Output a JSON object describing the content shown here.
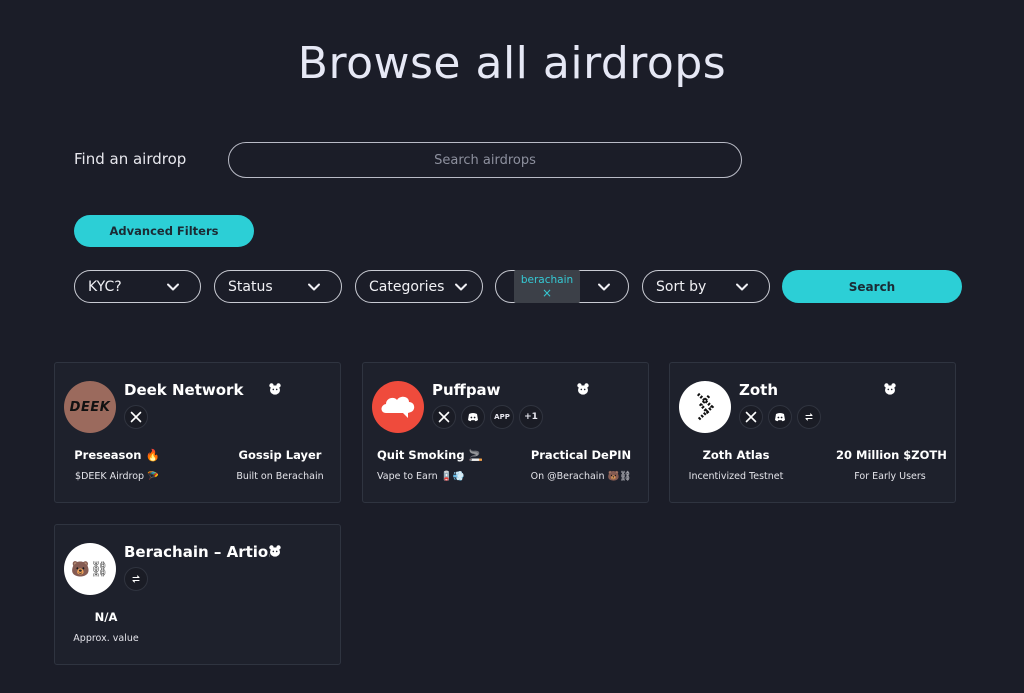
{
  "page": {
    "title": "Browse all airdrops"
  },
  "search": {
    "label": "Find an airdrop",
    "placeholder": "Search airdrops",
    "value": ""
  },
  "advanced_filters": {
    "label": "Advanced Filters"
  },
  "filters": {
    "kyc": "KYC?",
    "status": "Status",
    "categories": "Categories",
    "chain_tag": "berachain",
    "chain_tag_remove": "×",
    "sort": "Sort by"
  },
  "search_button": {
    "label": "Search"
  },
  "colors": {
    "accent": "#2ccfd6",
    "background": "#1b1d28",
    "card": "#1e212c"
  },
  "cards": [
    {
      "name": "Deek Network",
      "logo_text": "DEEK",
      "socials": [
        "x-icon"
      ],
      "left_title": "Preseason 🔥",
      "left_sub": "$DEEK Airdrop 🪂",
      "right_title": "Gossip Layer",
      "right_sub": "Built on Berachain"
    },
    {
      "name": "Puffpaw",
      "socials": [
        "x-icon",
        "discord-icon",
        "app-icon",
        "more-count"
      ],
      "app_label": "APP",
      "more_label": "+1",
      "left_title": "Quit Smoking 🚬",
      "left_sub": "Vape to Earn 🪫💨",
      "right_title": "Practical DePIN",
      "right_sub": "On @Berachain 🐻⛓"
    },
    {
      "name": "Zoth",
      "socials": [
        "x-icon",
        "discord-icon",
        "link-icon"
      ],
      "left_title": "Zoth Atlas",
      "left_sub": "Incentivized Testnet",
      "right_title": "20 Million $ZOTH",
      "right_sub": "For Early Users"
    },
    {
      "name": "Berachain – Artio...",
      "logo_text": "🐻⛓",
      "socials": [
        "link-icon"
      ],
      "left_title": "N/A",
      "left_sub": "Approx. value"
    }
  ]
}
